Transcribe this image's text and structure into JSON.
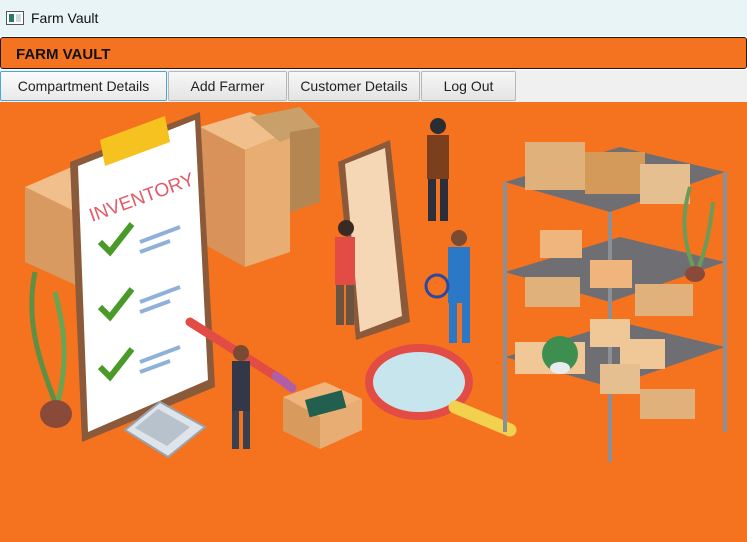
{
  "window": {
    "title": "Farm Vault"
  },
  "brand": {
    "name": "FARM VAULT"
  },
  "tabs": [
    {
      "label": "Compartment Details",
      "active": true
    },
    {
      "label": "Add Farmer",
      "active": false
    },
    {
      "label": "Customer Details",
      "active": false
    },
    {
      "label": "Log Out",
      "active": false
    }
  ],
  "illustration": {
    "clipboard_heading": "INVENTORY"
  },
  "colors": {
    "accent": "#f47321",
    "active_tab_border": "#49a8d6"
  }
}
